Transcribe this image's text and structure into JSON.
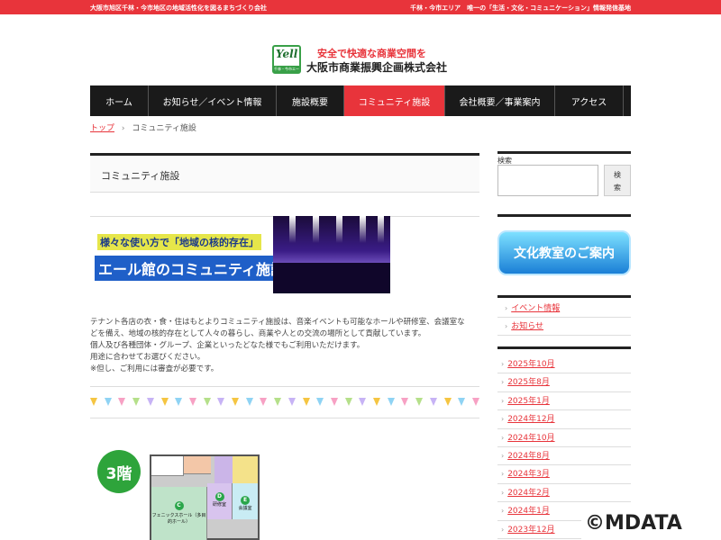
{
  "topbar": {
    "left": "大阪市旭区千林・今市地区の地域活性化を図るまちづくり会社",
    "right": "千林・今市エリア　唯一の「生活・文化・コミュニケーション」情報発信基地"
  },
  "header": {
    "logo_text": "Yell",
    "logo_sub": "千林・今市エール館",
    "tagline": "安全で快適な商業空間を",
    "company": "大阪市商業振興企画株式会社"
  },
  "nav": {
    "items": [
      {
        "label": "ホーム"
      },
      {
        "label": "お知らせ／イベント情報"
      },
      {
        "label": "施設概要"
      },
      {
        "label": "コミュニティ施設"
      },
      {
        "label": "会社概要／事業案内"
      },
      {
        "label": "アクセス"
      }
    ]
  },
  "breadcrumb": {
    "home": "トップ",
    "sep": "›",
    "current": "コミュニティ施設"
  },
  "main": {
    "title": "コミュニティ施設",
    "banner": {
      "line1": "様々な使い方で「地域の核的存在」",
      "line2": "エール館のコミュニティ施設"
    },
    "description": [
      "テナント各店の衣・食・住はもとよりコミュニティ施設は、音楽イベントも可能なホールや研修室、会議室な",
      "どを備え、地域の核的存在として人々の暮らし、商業や人との交流の場所として貢献しています。",
      "個人及び各種団体・グループ、企業といったどなた様でもご利用いただけます。",
      "用途に合わせてお選びください。",
      "※但し、ご利用には審査が必要です。"
    ],
    "floor_label": "3階",
    "plan": {
      "room_c_badge": "C",
      "room_c_label": "フェニックスホール（多目的ホール）",
      "room_d_badge": "D",
      "room_d_label": "研修室",
      "room_e_badge": "E",
      "room_e_label": "会議室"
    }
  },
  "sidebar": {
    "search_label": "検索",
    "search_placeholder": "",
    "search_button": "検索",
    "culture_banner": "文化教室のご案内",
    "links": [
      {
        "label": "イベント情報"
      },
      {
        "label": "お知らせ"
      }
    ],
    "archive": [
      {
        "label": "2025年10月"
      },
      {
        "label": "2025年8月"
      },
      {
        "label": "2025年1月"
      },
      {
        "label": "2024年12月"
      },
      {
        "label": "2024年10月"
      },
      {
        "label": "2024年8月"
      },
      {
        "label": "2024年3月"
      },
      {
        "label": "2024年2月"
      },
      {
        "label": "2024年1月"
      },
      {
        "label": "2023年12月"
      }
    ]
  },
  "watermark": "©MDATA",
  "colors": {
    "accent": "#e8343b",
    "nav_bg": "#1a1a1a",
    "green": "#39a048"
  }
}
